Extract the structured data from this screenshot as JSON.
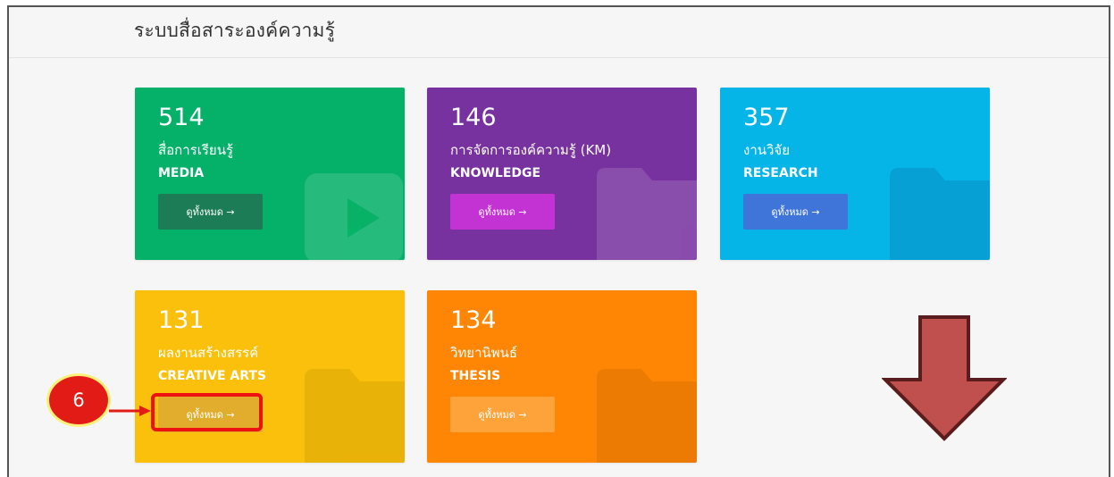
{
  "page": {
    "title": "ระบบสื่อสาระองค์ความรู้"
  },
  "cards": [
    {
      "count": "514",
      "thai": "สื่อการเรียนรู้",
      "eng": "MEDIA",
      "button": "ดูทั้งหมด →",
      "bg": "#05b169",
      "btn_bg": "#1c7c56"
    },
    {
      "count": "146",
      "thai": "การจัดการองค์ความรู้ (KM)",
      "eng": "KNOWLEDGE",
      "button": "ดูทั้งหมด →",
      "bg": "#7832a0",
      "btn_bg": "#c332d2"
    },
    {
      "count": "357",
      "thai": "งานวิจัย",
      "eng": "RESEARCH",
      "button": "ดูทั้งหมด →",
      "bg": "#05b5e8",
      "btn_bg": "#3f74d8"
    },
    {
      "count": "131",
      "thai": "ผลงานสร้างสรรค์",
      "eng": "CREATIVE ARTS",
      "button": "ดูทั้งหมด →",
      "bg": "#fbc00b",
      "btn_bg": "#e2ad2c"
    },
    {
      "count": "134",
      "thai": "วิทยานิพนธ์",
      "eng": "THESIS",
      "button": "ดูทั้งหมด →",
      "bg": "#fe8604",
      "btn_bg": "#fda33a"
    }
  ],
  "annotation": {
    "step": "6",
    "color": "#e31b17"
  },
  "scroll_arrow": {
    "color": "#c0504d",
    "outline": "#5a1c1c"
  }
}
